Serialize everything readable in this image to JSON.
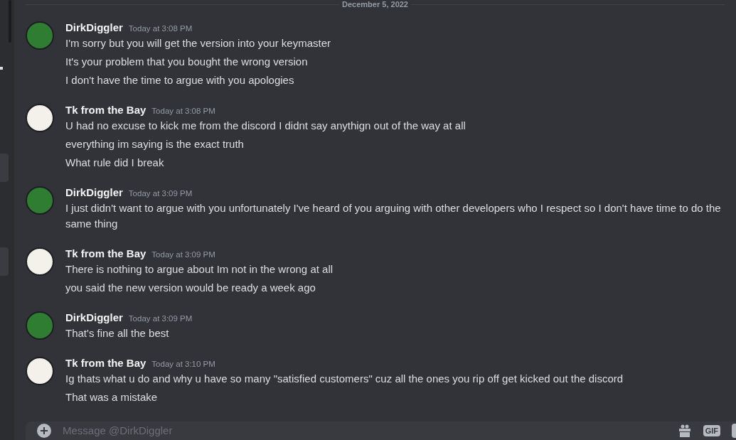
{
  "date_divider": "December 5, 2022",
  "groups": [
    {
      "author": "DirkDiggler",
      "color": "#2f7d32",
      "timestamp": "Today at 3:08 PM",
      "lines": [
        "I'm sorry but you will get the version into your keymaster",
        "It's your problem that you bought the wrong version",
        "I don't have the time to argue with you apologies"
      ]
    },
    {
      "author": "Tk from the Bay",
      "color": "#f4f1ea",
      "timestamp": "Today at 3:08 PM",
      "lines": [
        "U had no excuse to kick me from the discord I didnt say anythign out of the way at all",
        "everything im saying is the exact truth",
        "What rule did I break"
      ]
    },
    {
      "author": "DirkDiggler",
      "color": "#2f7d32",
      "timestamp": "Today at 3:09 PM",
      "lines": [
        "I just didn't want to argue with you unfortunately I've heard of you arguing with other developers who I respect so I don't have time to do the same thing"
      ]
    },
    {
      "author": "Tk from the Bay",
      "color": "#f4f1ea",
      "timestamp": "Today at 3:09 PM",
      "lines": [
        "There is nothing to argue about Im not in the wrong at all",
        "you said the new version would be ready a week ago"
      ]
    },
    {
      "author": "DirkDiggler",
      "color": "#2f7d32",
      "timestamp": "Today at 3:09 PM",
      "lines": [
        "That's fine all the best"
      ]
    },
    {
      "author": "Tk from the Bay",
      "color": "#f4f1ea",
      "timestamp": "Today at 3:10 PM",
      "lines": [
        "Ig thats what u do and why u have so many \"satisfied customers\" cuz all the ones you rip off get kicked out the discord",
        "That was a mistake"
      ]
    }
  ],
  "composer": {
    "placeholder": "Message @DirkDiggler",
    "gif_label": "GIF"
  }
}
